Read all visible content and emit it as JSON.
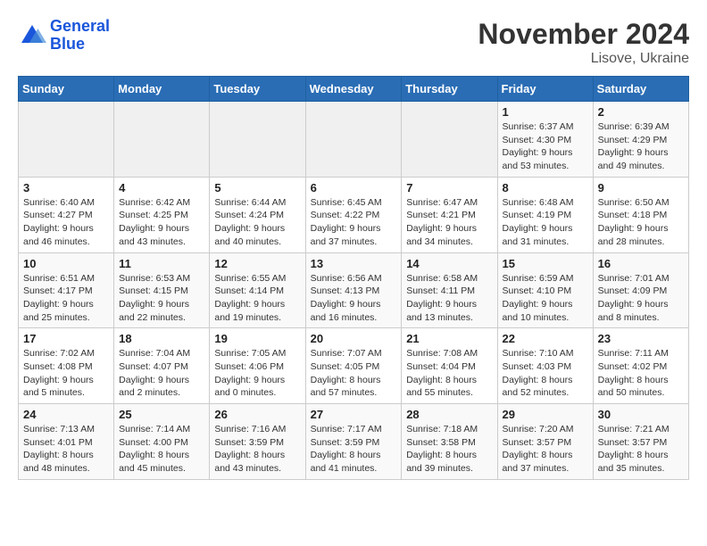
{
  "header": {
    "logo_line1": "General",
    "logo_line2": "Blue",
    "month": "November 2024",
    "location": "Lisove, Ukraine"
  },
  "weekdays": [
    "Sunday",
    "Monday",
    "Tuesday",
    "Wednesday",
    "Thursday",
    "Friday",
    "Saturday"
  ],
  "weeks": [
    [
      {
        "day": "",
        "info": ""
      },
      {
        "day": "",
        "info": ""
      },
      {
        "day": "",
        "info": ""
      },
      {
        "day": "",
        "info": ""
      },
      {
        "day": "",
        "info": ""
      },
      {
        "day": "1",
        "info": "Sunrise: 6:37 AM\nSunset: 4:30 PM\nDaylight: 9 hours\nand 53 minutes."
      },
      {
        "day": "2",
        "info": "Sunrise: 6:39 AM\nSunset: 4:29 PM\nDaylight: 9 hours\nand 49 minutes."
      }
    ],
    [
      {
        "day": "3",
        "info": "Sunrise: 6:40 AM\nSunset: 4:27 PM\nDaylight: 9 hours\nand 46 minutes."
      },
      {
        "day": "4",
        "info": "Sunrise: 6:42 AM\nSunset: 4:25 PM\nDaylight: 9 hours\nand 43 minutes."
      },
      {
        "day": "5",
        "info": "Sunrise: 6:44 AM\nSunset: 4:24 PM\nDaylight: 9 hours\nand 40 minutes."
      },
      {
        "day": "6",
        "info": "Sunrise: 6:45 AM\nSunset: 4:22 PM\nDaylight: 9 hours\nand 37 minutes."
      },
      {
        "day": "7",
        "info": "Sunrise: 6:47 AM\nSunset: 4:21 PM\nDaylight: 9 hours\nand 34 minutes."
      },
      {
        "day": "8",
        "info": "Sunrise: 6:48 AM\nSunset: 4:19 PM\nDaylight: 9 hours\nand 31 minutes."
      },
      {
        "day": "9",
        "info": "Sunrise: 6:50 AM\nSunset: 4:18 PM\nDaylight: 9 hours\nand 28 minutes."
      }
    ],
    [
      {
        "day": "10",
        "info": "Sunrise: 6:51 AM\nSunset: 4:17 PM\nDaylight: 9 hours\nand 25 minutes."
      },
      {
        "day": "11",
        "info": "Sunrise: 6:53 AM\nSunset: 4:15 PM\nDaylight: 9 hours\nand 22 minutes."
      },
      {
        "day": "12",
        "info": "Sunrise: 6:55 AM\nSunset: 4:14 PM\nDaylight: 9 hours\nand 19 minutes."
      },
      {
        "day": "13",
        "info": "Sunrise: 6:56 AM\nSunset: 4:13 PM\nDaylight: 9 hours\nand 16 minutes."
      },
      {
        "day": "14",
        "info": "Sunrise: 6:58 AM\nSunset: 4:11 PM\nDaylight: 9 hours\nand 13 minutes."
      },
      {
        "day": "15",
        "info": "Sunrise: 6:59 AM\nSunset: 4:10 PM\nDaylight: 9 hours\nand 10 minutes."
      },
      {
        "day": "16",
        "info": "Sunrise: 7:01 AM\nSunset: 4:09 PM\nDaylight: 9 hours\nand 8 minutes."
      }
    ],
    [
      {
        "day": "17",
        "info": "Sunrise: 7:02 AM\nSunset: 4:08 PM\nDaylight: 9 hours\nand 5 minutes."
      },
      {
        "day": "18",
        "info": "Sunrise: 7:04 AM\nSunset: 4:07 PM\nDaylight: 9 hours\nand 2 minutes."
      },
      {
        "day": "19",
        "info": "Sunrise: 7:05 AM\nSunset: 4:06 PM\nDaylight: 9 hours\nand 0 minutes."
      },
      {
        "day": "20",
        "info": "Sunrise: 7:07 AM\nSunset: 4:05 PM\nDaylight: 8 hours\nand 57 minutes."
      },
      {
        "day": "21",
        "info": "Sunrise: 7:08 AM\nSunset: 4:04 PM\nDaylight: 8 hours\nand 55 minutes."
      },
      {
        "day": "22",
        "info": "Sunrise: 7:10 AM\nSunset: 4:03 PM\nDaylight: 8 hours\nand 52 minutes."
      },
      {
        "day": "23",
        "info": "Sunrise: 7:11 AM\nSunset: 4:02 PM\nDaylight: 8 hours\nand 50 minutes."
      }
    ],
    [
      {
        "day": "24",
        "info": "Sunrise: 7:13 AM\nSunset: 4:01 PM\nDaylight: 8 hours\nand 48 minutes."
      },
      {
        "day": "25",
        "info": "Sunrise: 7:14 AM\nSunset: 4:00 PM\nDaylight: 8 hours\nand 45 minutes."
      },
      {
        "day": "26",
        "info": "Sunrise: 7:16 AM\nSunset: 3:59 PM\nDaylight: 8 hours\nand 43 minutes."
      },
      {
        "day": "27",
        "info": "Sunrise: 7:17 AM\nSunset: 3:59 PM\nDaylight: 8 hours\nand 41 minutes."
      },
      {
        "day": "28",
        "info": "Sunrise: 7:18 AM\nSunset: 3:58 PM\nDaylight: 8 hours\nand 39 minutes."
      },
      {
        "day": "29",
        "info": "Sunrise: 7:20 AM\nSunset: 3:57 PM\nDaylight: 8 hours\nand 37 minutes."
      },
      {
        "day": "30",
        "info": "Sunrise: 7:21 AM\nSunset: 3:57 PM\nDaylight: 8 hours\nand 35 minutes."
      }
    ]
  ]
}
